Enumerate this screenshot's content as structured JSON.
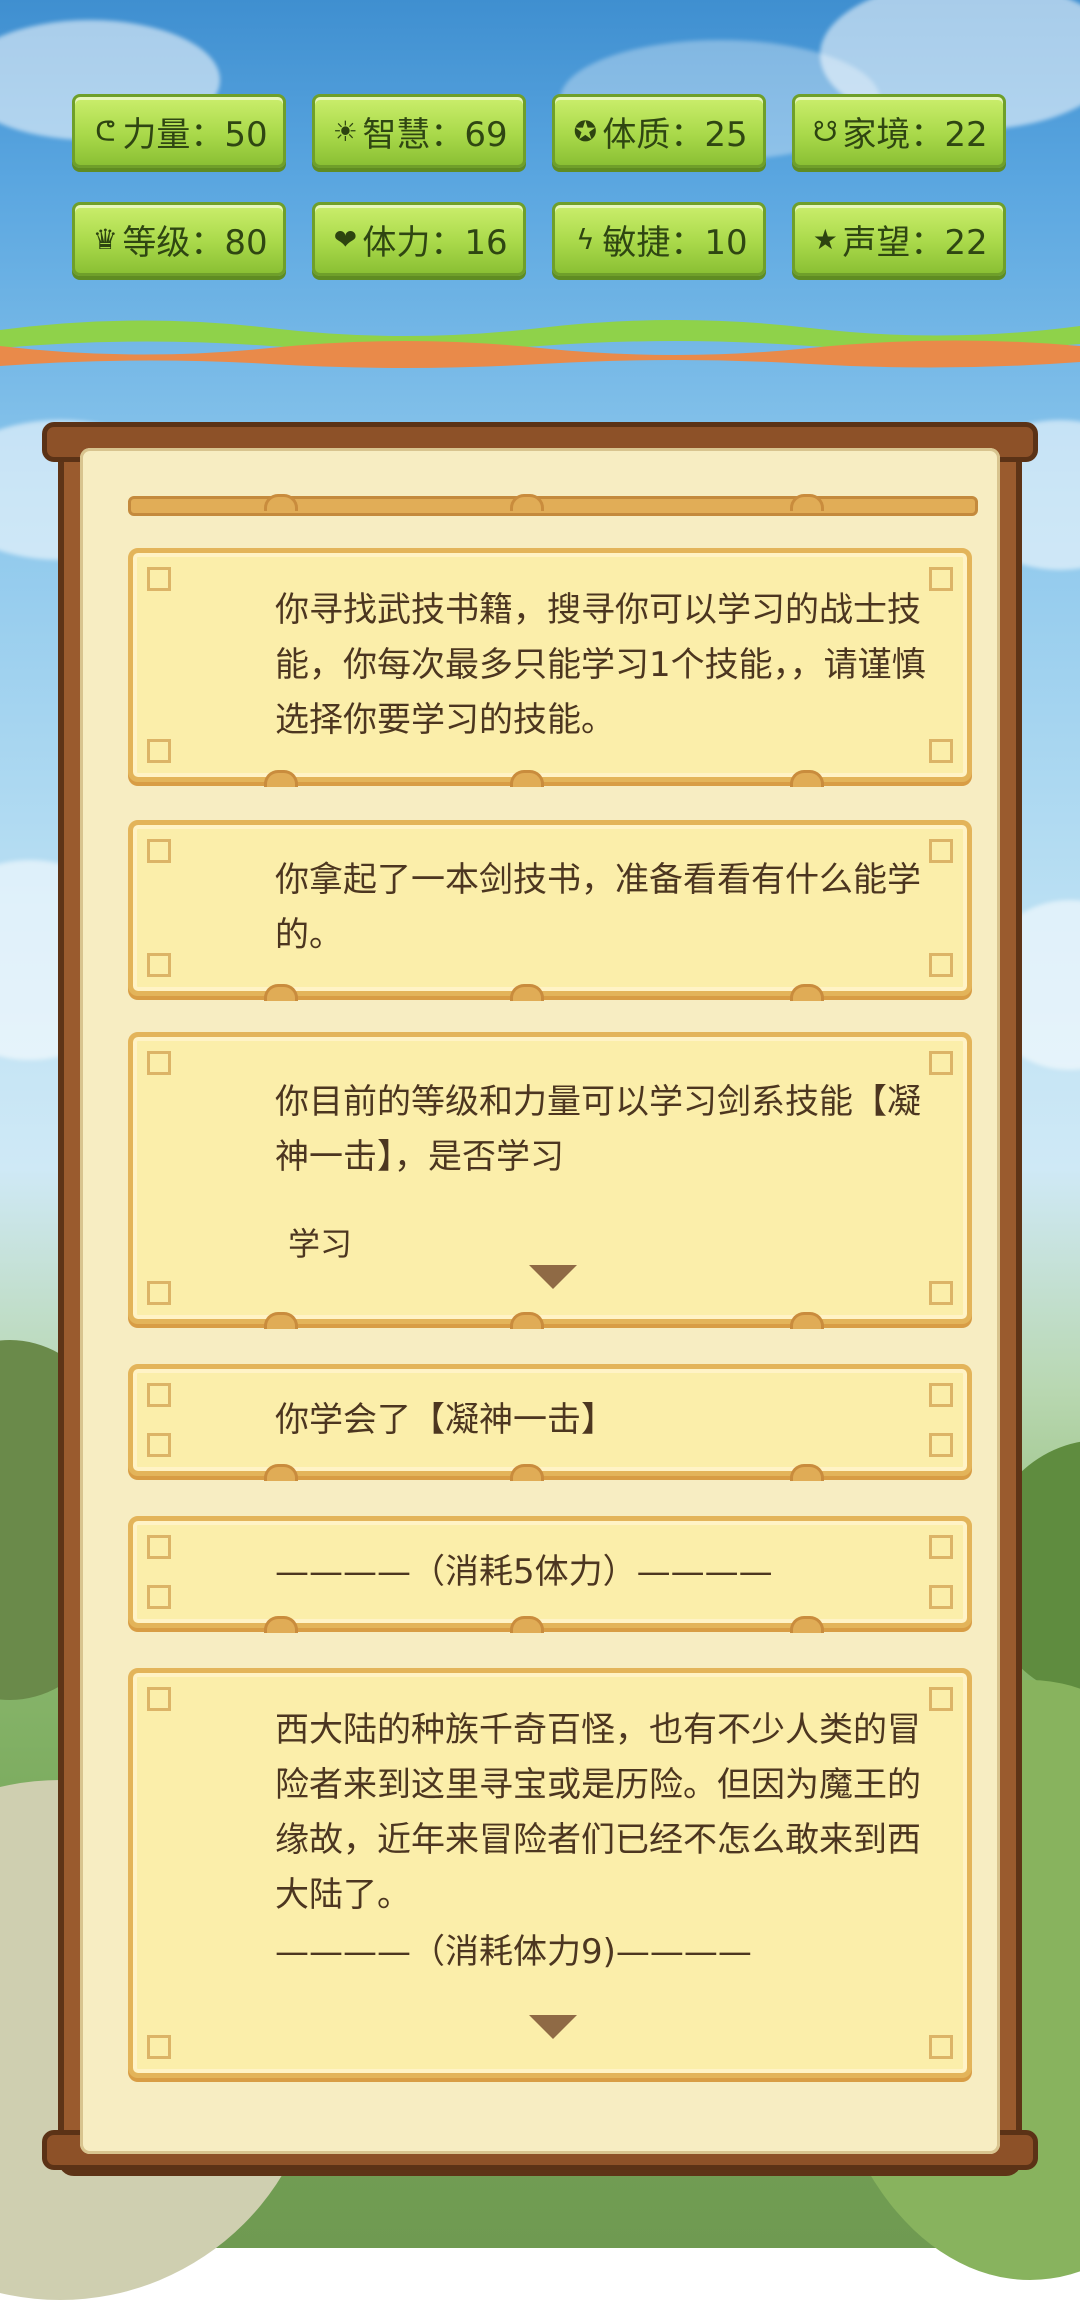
{
  "stats": [
    {
      "icon": "muscle-icon",
      "glyph": "ᕦ",
      "label": "力量：50"
    },
    {
      "icon": "lightbulb-icon",
      "glyph": "☀",
      "label": "智慧：69"
    },
    {
      "icon": "constitution-icon",
      "glyph": "✪",
      "label": "体质：25"
    },
    {
      "icon": "family-icon",
      "glyph": "☋",
      "label": "家境：22"
    },
    {
      "icon": "crown-icon",
      "glyph": "♛",
      "label": "等级：80"
    },
    {
      "icon": "heart-icon",
      "glyph": "❤",
      "label": "体力：16"
    },
    {
      "icon": "lightning-icon",
      "glyph": "ϟ",
      "label": "敏捷：10"
    },
    {
      "icon": "star-icon",
      "glyph": "★",
      "label": "声望：22"
    }
  ],
  "messages": [
    {
      "text": "你寻找武技书籍，搜寻你可以学习的战士技能，你每次最多只能学习1个技能，，请谨慎选择你要学习的技能。"
    },
    {
      "text": "你拿起了一本剑技书，准备看看有什么能学的。"
    },
    {
      "text": "你目前的等级和力量可以学习剑系技能【凝神一击】，是否学习",
      "option": "学习"
    },
    {
      "text": "你学会了【凝神一击】"
    },
    {
      "text": "————（消耗5体力）————"
    },
    {
      "text": "西大陆的种族千奇百怪，也有不少人类的冒险者来到这里寻宝或是历险。但因为魔王的缘故，近年来冒险者们已经不怎么敢来到西大陆了。",
      "footer": "————（消耗体力9)————"
    }
  ]
}
